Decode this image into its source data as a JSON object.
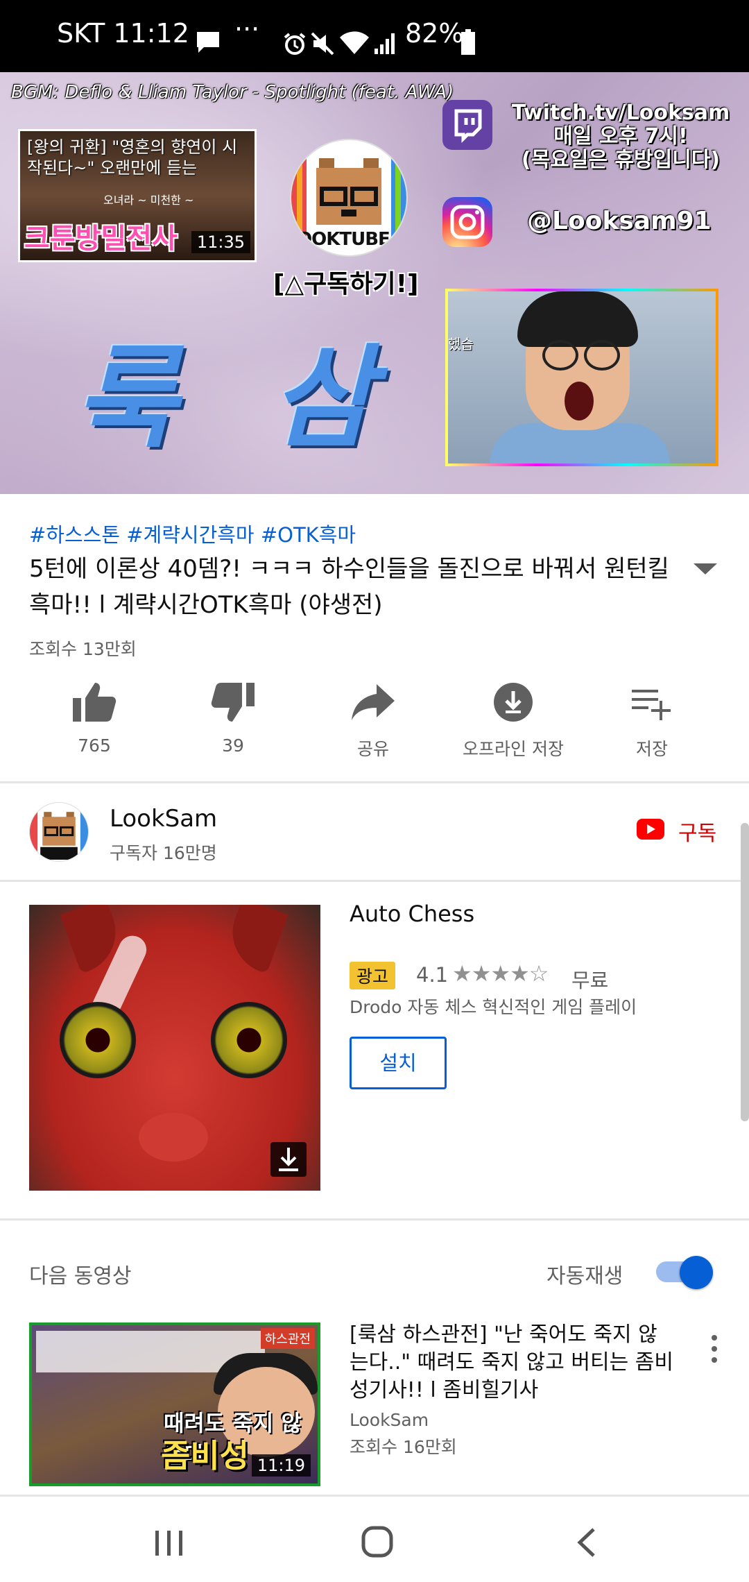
{
  "status_bar": {
    "carrier_time": "SKT 11:12",
    "battery": "82%",
    "icons": [
      "message-icon",
      "more-dots-icon",
      "alarm-icon",
      "mute-icon",
      "wifi-icon",
      "signal-icon",
      "battery-icon"
    ]
  },
  "video_overlay": {
    "bgm": "BGM: Deflo & Lliam Taylor - Spotlight (feat. AWA)",
    "mini_caption": "[왕의 귀환] \"영혼의 향연이 시작된다~\" 오랜만에 듣는",
    "mini_sub": "오녀라 ~ 미천한 ~",
    "mini_big": "크툰방밀전사",
    "mini_duration": "11:35",
    "logo_text": "OOKTUBE",
    "subscribe_hint": "[△구독하기!]",
    "big_name": "룩 삼",
    "twitch_text": "Twitch.tv/Looksam\n매일 오후 7시!\n(목요일은 휴방입니다)",
    "insta_text": "@Looksam91",
    "webcam_label": "했습"
  },
  "video_info": {
    "hashtags": "#하스스톤 #계략시간흑마 #OTK흑마",
    "title": "5턴에 이론상 40뎀?! ㅋㅋㅋ 하수인들을 돌진으로 바꿔서 원턴킬 흑마!! l 계략시간OTK흑마 (야생전)",
    "views": "조회수 13만회"
  },
  "actions": [
    {
      "name": "like-button",
      "icon": "thumbs-up-icon",
      "label": "765"
    },
    {
      "name": "dislike-button",
      "icon": "thumbs-down-icon",
      "label": "39"
    },
    {
      "name": "share-button",
      "icon": "share-icon",
      "label": "공유"
    },
    {
      "name": "offline-save-button",
      "icon": "download-icon",
      "label": "오프라인 저장"
    },
    {
      "name": "save-button",
      "icon": "playlist-add-icon",
      "label": "저장"
    }
  ],
  "channel": {
    "name": "LookSam",
    "subscribers": "구독자 16만명",
    "subscribe_label": "구독"
  },
  "ad": {
    "title": "Auto Chess",
    "badge": "광고",
    "rating": "4.1",
    "stars": "★★★★☆",
    "rating_value": 4.1,
    "price": "무료",
    "description": "Drodo 자동 체스 혁신적인 게임 플레이",
    "install_label": "설치"
  },
  "up_next": {
    "label": "다음 동영상",
    "autoplay_label": "자동재생",
    "autoplay_on": true,
    "video": {
      "thumb_tag": "하스관전",
      "thumb_text1": "때려도 죽지 않는다",
      "thumb_text2": "좀비성",
      "duration": "11:19",
      "title": "[룩삼 하스관전] \"난 죽어도 죽지 않는다..\" 때려도 죽지 않고 버티는 좀비성기사!! l 좀비힐기사",
      "channel": "LookSam",
      "views": "조회수 16만회"
    }
  },
  "colors": {
    "accent_blue": "#065fd4",
    "youtube_red": "#ff0000",
    "subscribe_red": "#cc0000",
    "ad_badge": "#f2c230"
  }
}
